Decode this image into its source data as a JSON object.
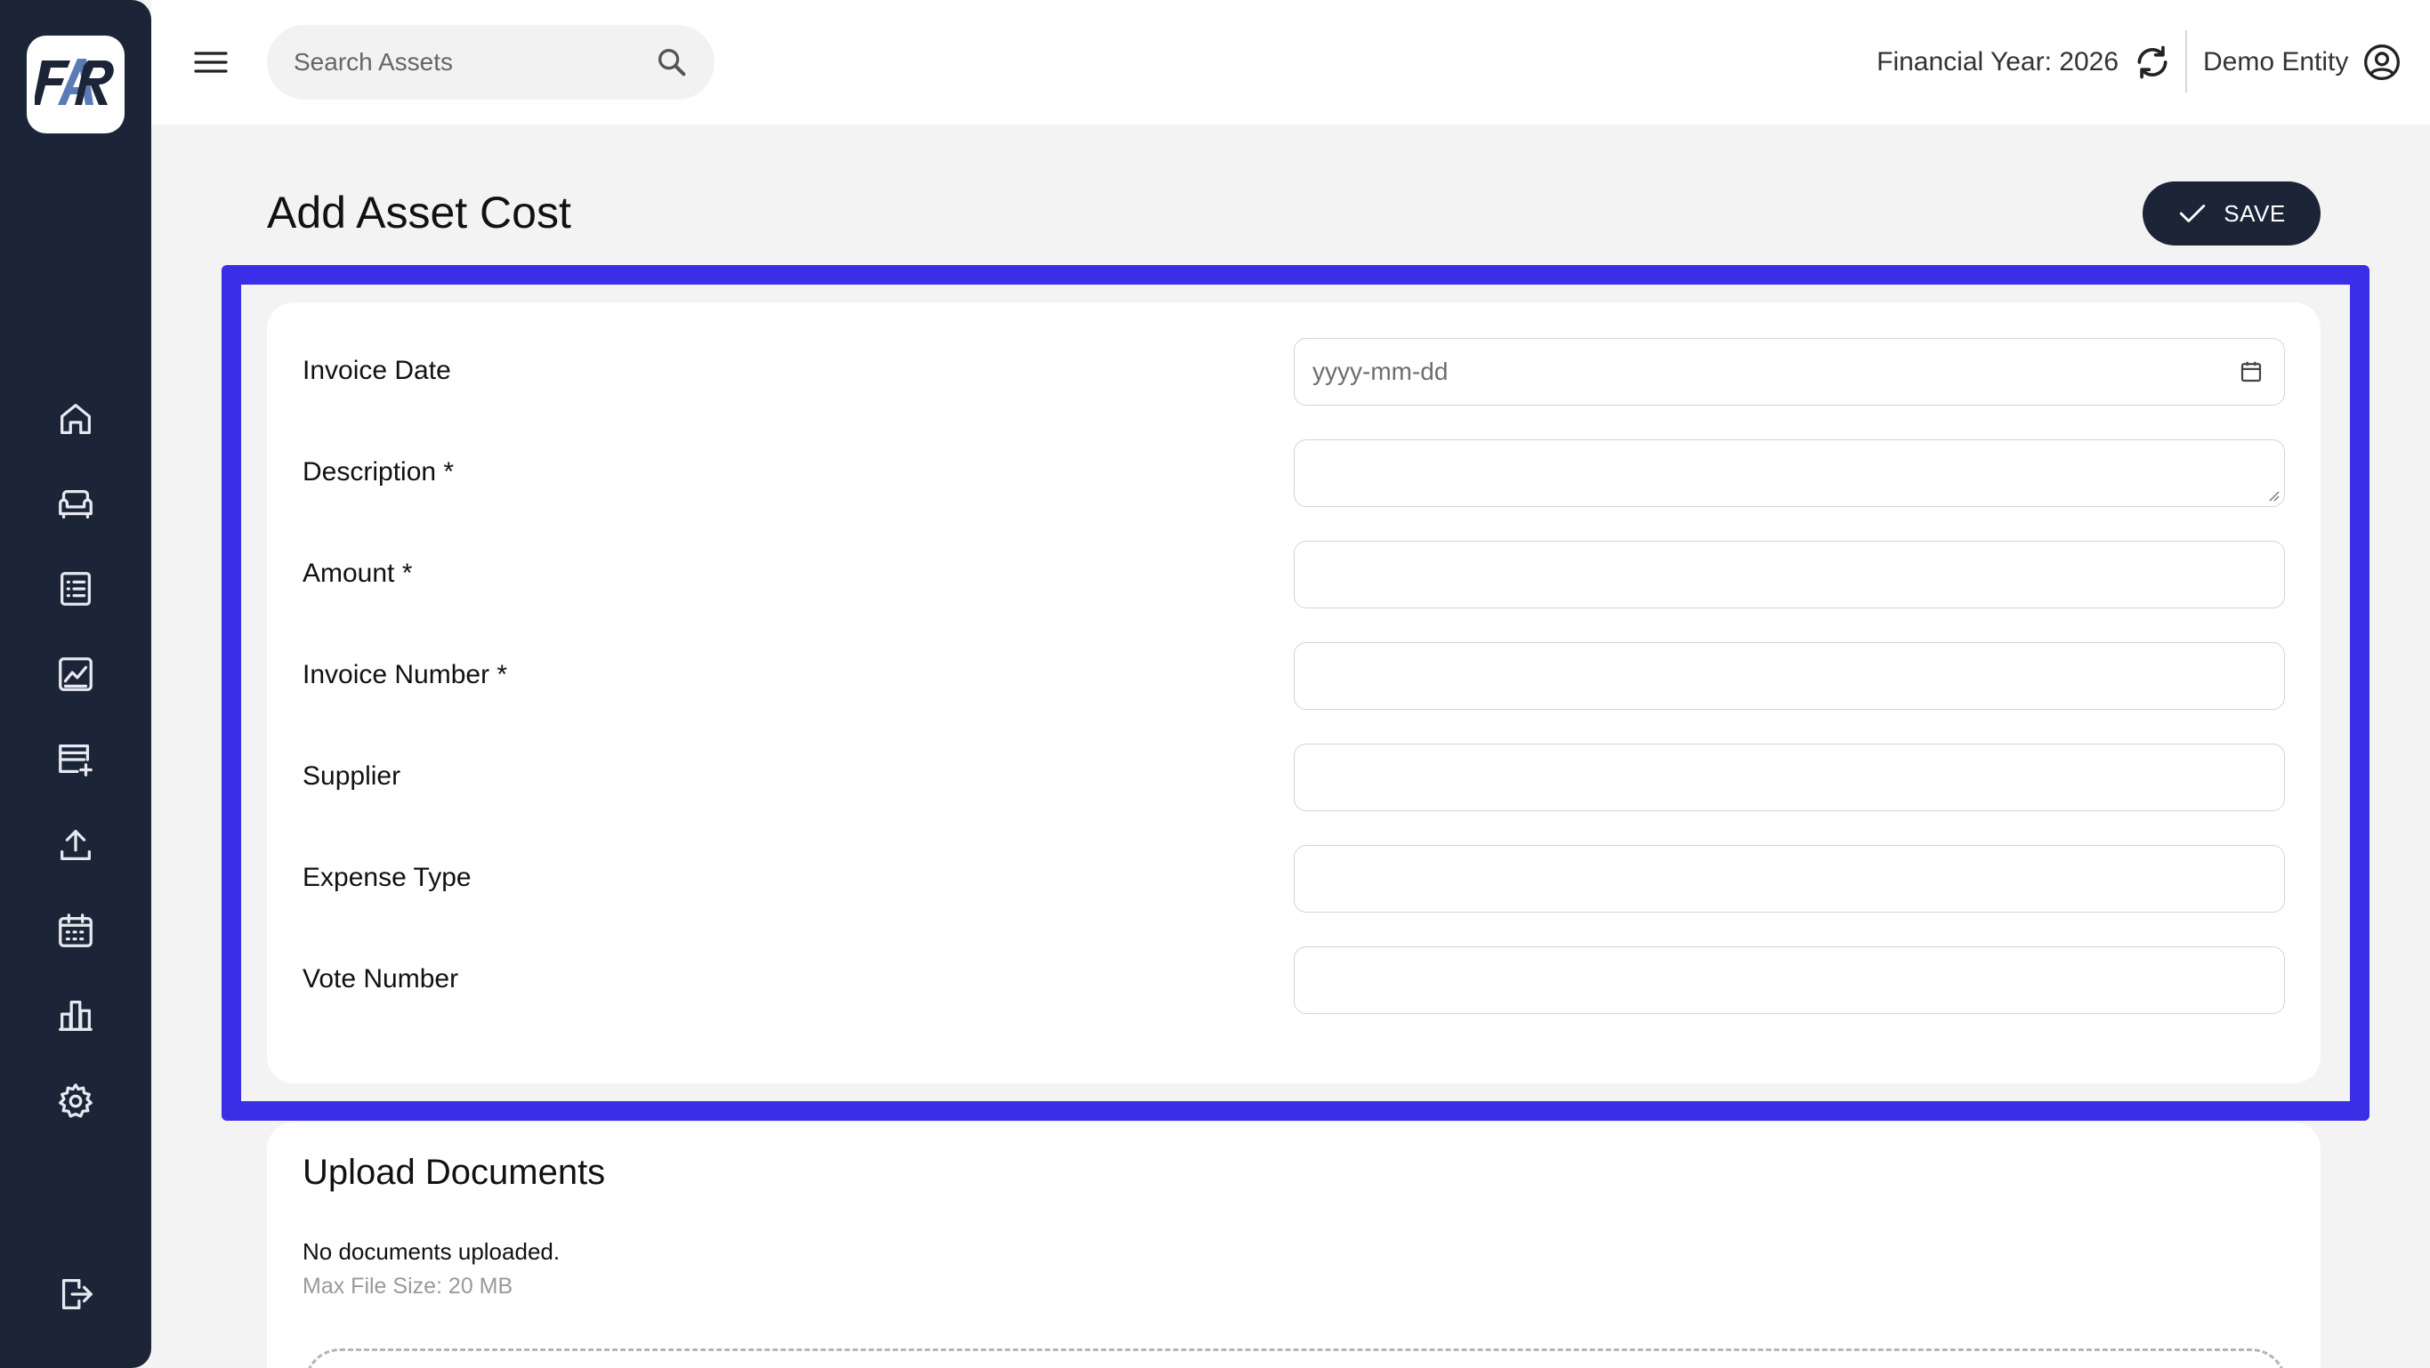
{
  "app": {
    "logo_text": "FAR"
  },
  "sidebar": {
    "items": [
      {
        "icon": "home-icon"
      },
      {
        "icon": "sofa-icon"
      },
      {
        "icon": "list-icon"
      },
      {
        "icon": "chart-icon"
      },
      {
        "icon": "store-add-icon"
      },
      {
        "icon": "upload-icon"
      },
      {
        "icon": "calendar-icon"
      },
      {
        "icon": "bar-chart-icon"
      },
      {
        "icon": "gear-icon"
      }
    ],
    "logout_icon": "logout-icon"
  },
  "topbar": {
    "search_placeholder": "Search Assets",
    "financial_year": "Financial Year: 2026",
    "entity": "Demo Entity"
  },
  "page": {
    "title": "Add Asset Cost",
    "save_label": "SAVE"
  },
  "form": {
    "fields": [
      {
        "label": "Invoice Date",
        "value": "",
        "placeholder": "yyyy-mm-dd"
      },
      {
        "label": "Description *",
        "value": ""
      },
      {
        "label": "Amount *",
        "value": ""
      },
      {
        "label": "Invoice Number *",
        "value": ""
      },
      {
        "label": "Supplier",
        "value": ""
      },
      {
        "label": "Expense Type",
        "value": ""
      },
      {
        "label": "Vote Number",
        "value": ""
      }
    ]
  },
  "upload": {
    "title": "Upload Documents",
    "empty_text": "No documents uploaded.",
    "max_size": "Max File Size: 20 MB"
  },
  "colors": {
    "sidebar_bg": "#1b2537",
    "highlight": "#3a2ee6",
    "page_bg": "#f3f3f3"
  }
}
